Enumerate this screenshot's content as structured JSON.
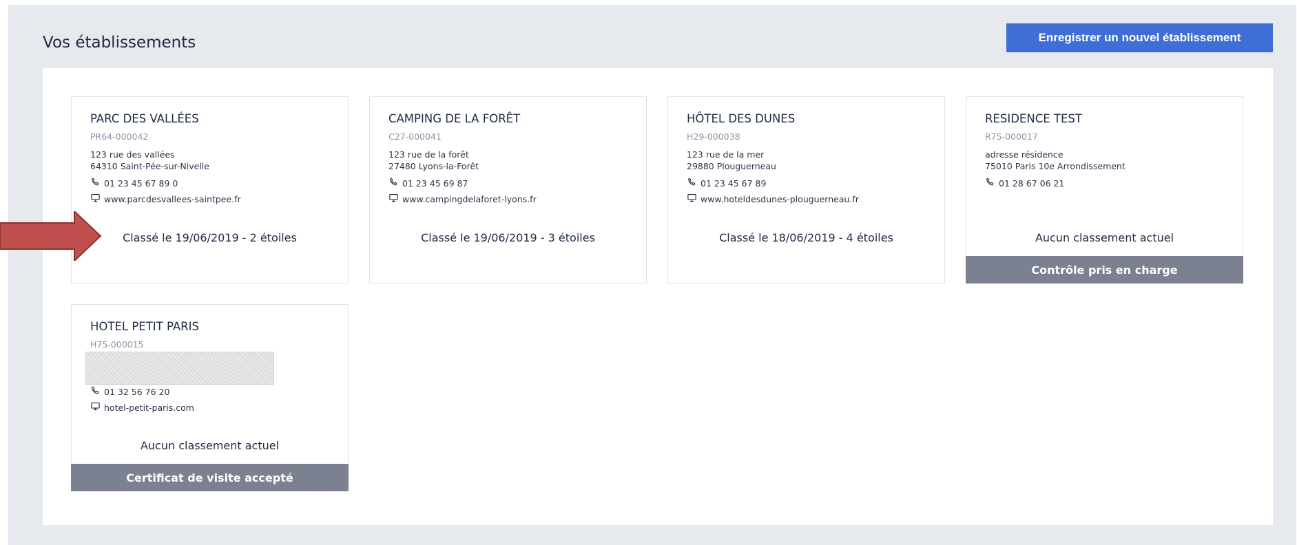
{
  "page": {
    "title": "Vos établissements",
    "new_button": "Enregistrer un nouvel établissement"
  },
  "colors": {
    "accent": "#3f6fd6",
    "status_bar": "#7b8190",
    "background": "#e6e9ed",
    "arrow": "#c0504d"
  },
  "establishments": [
    {
      "name": "PARC DES VALLÉES",
      "code": "PR64-000042",
      "address_line1": "123 rue des vallées",
      "address_line2": "64310 Saint-Pée-sur-Nivelle",
      "phone": "01 23 45 67 89 0",
      "website": "www.parcdesvallees-saintpee.fr",
      "rating": "Classé le 19/06/2019 - 2 étoiles",
      "status": ""
    },
    {
      "name": "CAMPING DE LA FORÊT",
      "code": "C27-000041",
      "address_line1": "123 rue de la forêt",
      "address_line2": "27480 Lyons-la-Forêt",
      "phone": "01 23 45 69 87",
      "website": "www.campingdelaforet-lyons.fr",
      "rating": "Classé le 19/06/2019 - 3 étoiles",
      "status": ""
    },
    {
      "name": "HÔTEL DES DUNES",
      "code": "H29-000038",
      "address_line1": "123 rue de la mer",
      "address_line2": "29880 Plouguerneau",
      "phone": "01 23 45 67 89",
      "website": "www.hoteldesdunes-plouguerneau.fr",
      "rating": "Classé le 18/06/2019 - 4 étoiles",
      "status": ""
    },
    {
      "name": "RESIDENCE TEST",
      "code": "R75-000017",
      "address_line1": "adresse résidence",
      "address_line2": "75010 Paris 10e Arrondissement",
      "phone": "01 28 67 06 21",
      "website": "",
      "rating": "Aucun classement actuel",
      "status": "Contrôle pris en charge"
    },
    {
      "name": "HOTEL PETIT PARIS",
      "code": "H75-000015",
      "address_line1": "",
      "address_line2": "",
      "phone": "01 32 56 76 20",
      "website": "hotel-petit-paris.com",
      "rating": "Aucun classement actuel",
      "status": "Certificat de visite accepté"
    }
  ]
}
